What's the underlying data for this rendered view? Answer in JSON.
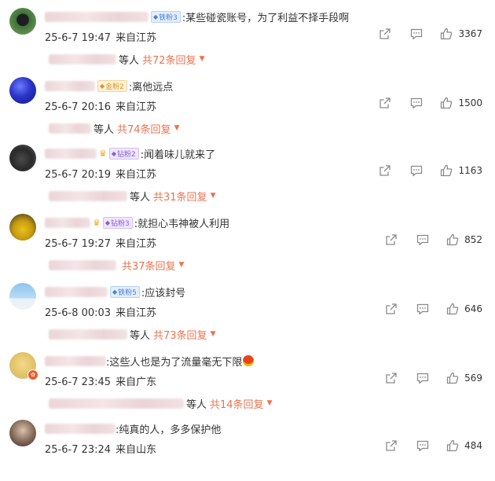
{
  "comments": [
    {
      "badge_type": "blue",
      "badge_text": "铁粉3",
      "text": ":某些碰瓷账号，为了利益不择手段啊",
      "time": "25-6-7 19:47",
      "location": "来自江苏",
      "likes": "3367",
      "reply_deng": "等人",
      "reply_total": "共72条回复"
    },
    {
      "badge_type": "gold",
      "badge_text": "金粉2",
      "text": ":离他远点",
      "time": "25-6-7 20:16",
      "location": "来自江苏",
      "likes": "1500",
      "reply_deng": "等人",
      "reply_total": "共74条回复"
    },
    {
      "badge_type": "purple",
      "badge_text": "钻粉2",
      "text": ":闻着味儿就来了",
      "time": "25-6-7 20:19",
      "location": "来自江苏",
      "likes": "1163",
      "reply_deng": "等人",
      "reply_total": "共31条回复"
    },
    {
      "badge_type": "purple",
      "badge_text": "钻粉3",
      "text": ":就担心韦神被人利用",
      "time": "25-6-7 19:27",
      "location": "来自江苏",
      "likes": "852",
      "reply_deng": "",
      "reply_total": "共37条回复"
    },
    {
      "badge_type": "blue",
      "badge_text": "铁粉5",
      "text": ":应该封号",
      "time": "25-6-8 00:03",
      "location": "来自江苏",
      "likes": "646",
      "reply_deng": "等人",
      "reply_total": "共73条回复"
    },
    {
      "badge_type": "",
      "badge_text": "",
      "text": ":这些人也是为了流量毫无下限",
      "time": "25-6-7 23:45",
      "location": "来自广东",
      "likes": "569",
      "reply_deng": "等人",
      "reply_total": "共14条回复"
    },
    {
      "badge_type": "",
      "badge_text": "",
      "text": ":纯真的人，多多保护他",
      "time": "25-6-7 23:24",
      "location": "来自山东",
      "likes": "484",
      "reply_deng": "",
      "reply_total": ""
    }
  ],
  "colors": {
    "reply_link": "#eb7350",
    "icon": "#8a8a8a"
  }
}
